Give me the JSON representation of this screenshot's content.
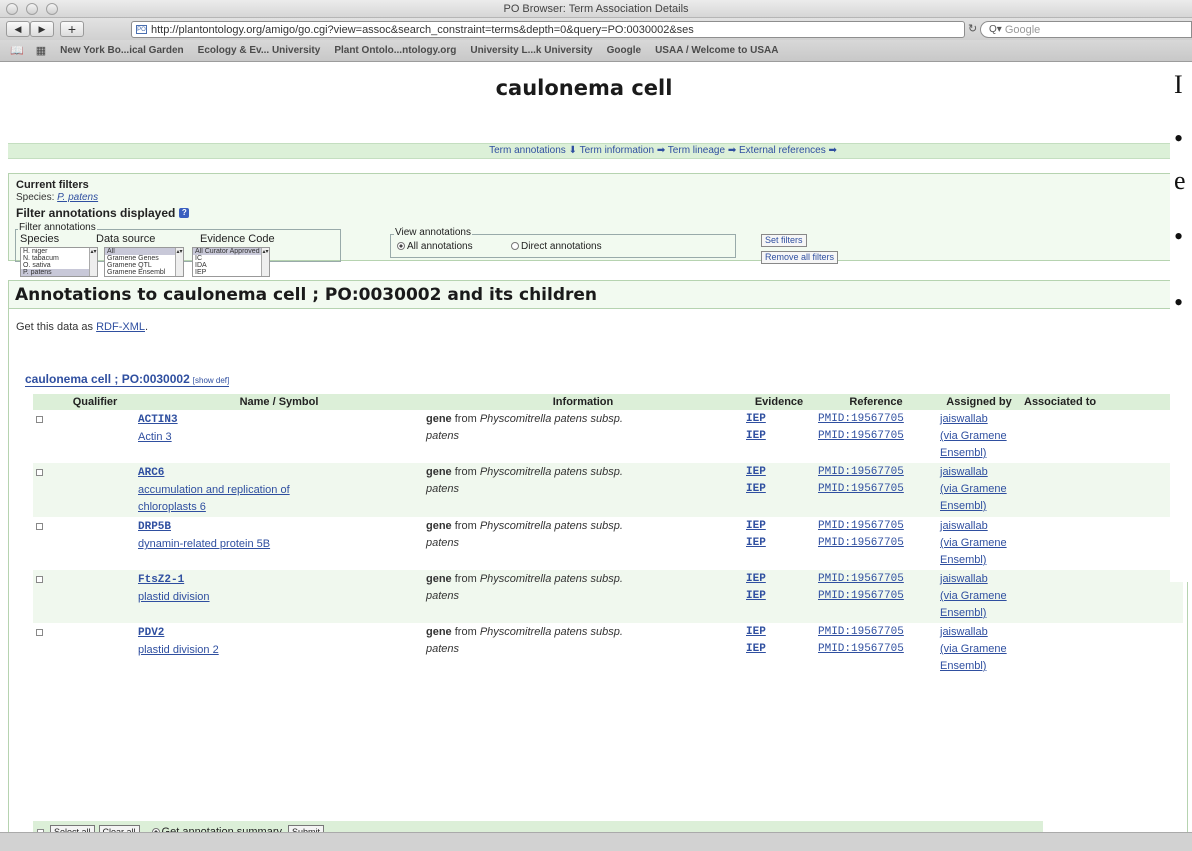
{
  "browser": {
    "window_title": "PO Browser: Term Association Details",
    "url": "http://plantontology.org/amigo/go.cgi?view=assoc&search_constraint=terms&depth=0&query=PO:0030002&ses",
    "search_placeholder": "Google",
    "bookmarks": [
      "New York Bo...ical Garden",
      "Ecology & Ev... University",
      "Plant Ontolo...ntology.org",
      "University L...k University",
      "Google",
      "USAA / Welcome to USAA"
    ]
  },
  "page": {
    "title": "caulonema cell",
    "nav_links": [
      "Term annotations",
      "Term information",
      "Term lineage",
      "External references"
    ],
    "current_filters_title": "Current filters",
    "species_label": "Species:",
    "species_value": "P. patens",
    "filter_title": "Filter annotations displayed",
    "filter_legend": "Filter annotations",
    "col_species": "Species",
    "col_data_source": "Data source",
    "col_evidence": "Evidence Code",
    "species_list": [
      "H. niger",
      "N. tabacum",
      "O. sativa",
      "P. patens"
    ],
    "source_list": [
      "All",
      "Gramene Genes",
      "Gramene QTL",
      "Gramene Ensembl"
    ],
    "evidence_list": [
      "All Curator Approved",
      "IC",
      "IDA",
      "IEP"
    ],
    "view_legend": "View annotations",
    "view_all": "All annotations",
    "view_direct": "Direct annotations",
    "set_filters": "Set filters",
    "remove_filters": "Remove all filters",
    "annotations_heading": "Annotations to caulonema cell ; PO:0030002 and its children",
    "rdf_prefix": "Get this data as",
    "rdf_link": "RDF-XML",
    "rdf_suffix": ".",
    "term_label": "caulonema cell ; PO:0030002",
    "show_def": "[show def]",
    "columns": [
      "Qualifier",
      "Name / Symbol",
      "Information",
      "Evidence",
      "Reference",
      "Assigned by",
      "Associated to"
    ],
    "rows": [
      {
        "symbol": "ACTIN3",
        "name": [
          "Actin 3"
        ],
        "info_bold": "gene",
        "info_from": "from",
        "info_species": "Physcomitrella patens subsp.",
        "info_species2": "patens",
        "evidence": [
          "IEP",
          "IEP"
        ],
        "reference": [
          "PMID:19567705",
          "PMID:19567705"
        ],
        "assigned": [
          "jaiswallab",
          "(via Gramene",
          "Ensembl)"
        ]
      },
      {
        "symbol": "ARC6",
        "name": [
          "accumulation and replication of",
          "chloroplasts 6"
        ],
        "info_bold": "gene",
        "info_from": "from",
        "info_species": "Physcomitrella patens subsp.",
        "info_species2": "patens",
        "evidence": [
          "IEP",
          "IEP"
        ],
        "reference": [
          "PMID:19567705",
          "PMID:19567705"
        ],
        "assigned": [
          "jaiswallab",
          "(via Gramene",
          "Ensembl)"
        ]
      },
      {
        "symbol": "DRP5B",
        "name": [
          "dynamin-related protein 5B"
        ],
        "info_bold": "gene",
        "info_from": "from",
        "info_species": "Physcomitrella patens subsp.",
        "info_species2": "patens",
        "evidence": [
          "IEP",
          "IEP"
        ],
        "reference": [
          "PMID:19567705",
          "PMID:19567705"
        ],
        "assigned": [
          "jaiswallab",
          "(via Gramene",
          "Ensembl)"
        ]
      },
      {
        "symbol": "FtsZ2-1",
        "name": [
          "plastid division"
        ],
        "info_bold": "gene",
        "info_from": "from",
        "info_species": "Physcomitrella patens subsp.",
        "info_species2": "patens",
        "evidence": [
          "IEP",
          "IEP"
        ],
        "reference": [
          "PMID:19567705",
          "PMID:19567705"
        ],
        "assigned": [
          "jaiswallab",
          "(via Gramene",
          "Ensembl)"
        ]
      },
      {
        "symbol": "PDV2",
        "name": [
          "plastid division 2"
        ],
        "info_bold": "gene",
        "info_from": "from",
        "info_species": "Physcomitrella patens subsp.",
        "info_species2": "patens",
        "evidence": [
          "IEP",
          "IEP"
        ],
        "reference": [
          "PMID:19567705",
          "PMID:19567705"
        ],
        "assigned": [
          "jaiswallab",
          "(via Gramene",
          "Ensembl)"
        ]
      }
    ],
    "select_all": "Select all",
    "clear_all": "Clear all",
    "get_summary": "Get annotation summary",
    "submit": "Submit"
  },
  "overlay": {
    "glyphs": [
      "I",
      "•",
      "e",
      "•",
      "•"
    ]
  },
  "colors": {
    "link": "#2f4fa0",
    "band": "#dcefd8",
    "panel": "#f2faf0"
  }
}
